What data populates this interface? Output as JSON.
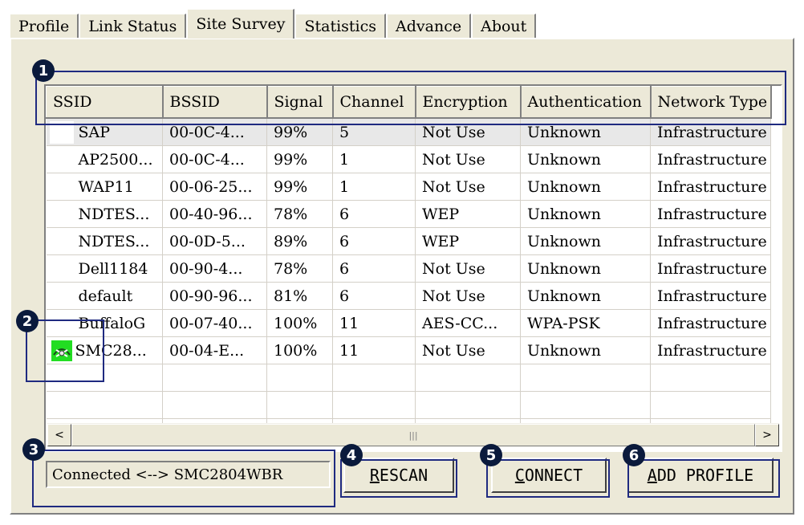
{
  "tabs": [
    "Profile",
    "Link Status",
    "Site Survey",
    "Statistics",
    "Advance",
    "About"
  ],
  "active_tab": "Site Survey",
  "table": {
    "columns": [
      "SSID",
      "BSSID",
      "Signal",
      "Channel",
      "Encryption",
      "Authentication",
      "Network Type"
    ],
    "rows": [
      [
        "SAP",
        "00-0C-4...",
        "99%",
        "5",
        "Not Use",
        "Unknown",
        "Infrastructure"
      ],
      [
        "AP2500...",
        "00-0C-4...",
        "99%",
        "1",
        "Not Use",
        "Unknown",
        "Infrastructure"
      ],
      [
        "WAP11",
        "00-06-25...",
        "99%",
        "1",
        "Not Use",
        "Unknown",
        "Infrastructure"
      ],
      [
        "NDTES...",
        "00-40-96...",
        "78%",
        "6",
        "WEP",
        "Unknown",
        "Infrastructure"
      ],
      [
        "NDTES...",
        "00-0D-5...",
        "89%",
        "6",
        "WEP",
        "Unknown",
        "Infrastructure"
      ],
      [
        "Dell1184",
        "00-90-4...",
        "78%",
        "6",
        "Not Use",
        "Unknown",
        "Infrastructure"
      ],
      [
        "default",
        "00-90-96...",
        "81%",
        "6",
        "Not Use",
        "Unknown",
        "Infrastructure"
      ],
      [
        "BuffaloG",
        "00-07-40...",
        "100%",
        "11",
        "AES-CC...",
        "WPA-PSK",
        "Infrastructure"
      ],
      [
        "SMC28...",
        "00-04-E...",
        "100%",
        "11",
        "Not Use",
        "Unknown",
        "Infrastructure"
      ]
    ],
    "connected_row_icon": "connected-network-icon"
  },
  "status": {
    "text": "Connected <--> SMC2804WBR"
  },
  "buttons": {
    "rescan_mnemonic": "R",
    "rescan_rest": "ESCAN",
    "connect_mnemonic": "C",
    "connect_rest": "ONNECT",
    "add_profile_mnemonic": "A",
    "add_profile_rest": "DD PROFILE"
  },
  "scrollbar": {
    "left_arrow": "<",
    "right_arrow": ">",
    "thumb_grip": "|||"
  },
  "callouts": [
    "1",
    "2",
    "3",
    "4",
    "5",
    "6"
  ],
  "colors": {
    "callout_border": "#1f2a80",
    "badge": "#0a1a3c",
    "icon_bg": "#22dd22",
    "panel": "#ece9d8"
  }
}
